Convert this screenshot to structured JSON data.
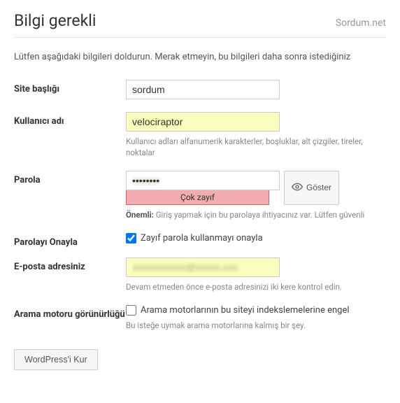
{
  "header": {
    "title": "Bilgi gerekli",
    "brand": "Sordum.net"
  },
  "intro": "Lütfen aşağıdaki bilgileri doldurun. Merak etmeyin, bu bilgileri daha sonra istediğiniz",
  "site_title": {
    "label": "Site başlığı",
    "value": "sordum"
  },
  "username": {
    "label": "Kullanıcı adı",
    "value": "velociraptor",
    "hint": "Kullanıcı adları alfanumerik karakterler, boşluklar, alt çizgiler, tireler, noktalar"
  },
  "password": {
    "label": "Parola",
    "value": "••••••••",
    "toggle": "Göster",
    "strength": "Çok zayıf",
    "hint_strong": "Önemli:",
    "hint_text": " Giriş yapmak için bu parolaya ihtiyacınız var. Lütfen güvenli"
  },
  "confirm_pw": {
    "label": "Parolayı Onayla",
    "checkbox_label": "Zayıf parola kullanmayı onayla",
    "checked": true
  },
  "email": {
    "label": "E-posta adresiniz",
    "value": "hidden",
    "hint": "Devam etmeden önce e-posta adresinizi iki kere kontrol edin."
  },
  "search_engine": {
    "label": "Arama motoru görünürlüğü",
    "checkbox_label": "Arama motorlarının bu siteyi indekslemelerine engel",
    "hint": "Bu isteğe uymak arama motorlarına kalmış bir şey.",
    "checked": false
  },
  "submit": {
    "label": "WordPress'i Kur"
  }
}
